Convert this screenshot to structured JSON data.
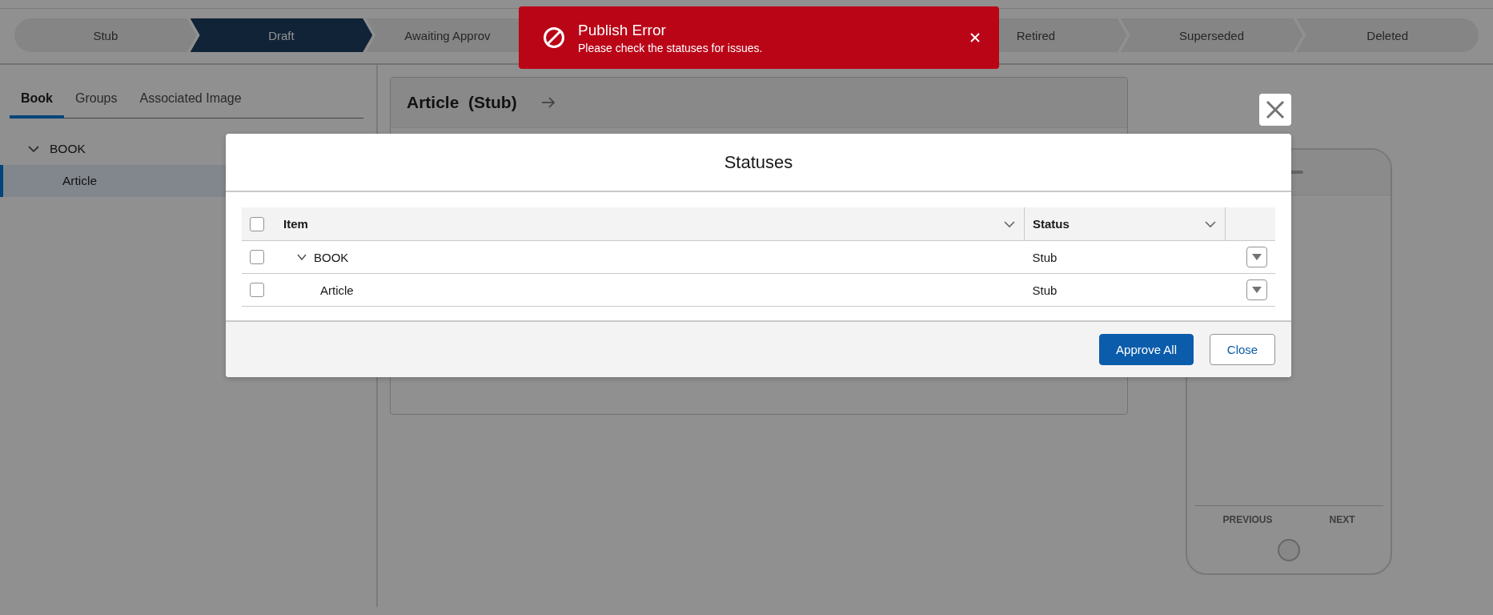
{
  "path": {
    "stages": [
      {
        "label": "Stub",
        "selected": false
      },
      {
        "label": "Draft",
        "selected": true
      },
      {
        "label": "Awaiting Approv",
        "selected": false
      },
      {
        "label": "Retired",
        "selected": false
      },
      {
        "label": "Superseded",
        "selected": false
      },
      {
        "label": "Deleted",
        "selected": false
      }
    ]
  },
  "sidebar": {
    "tabs": [
      {
        "label": "Book",
        "selected": true
      },
      {
        "label": "Groups",
        "selected": false
      },
      {
        "label": "Associated Image",
        "selected": false
      }
    ],
    "tree": [
      {
        "label": "BOOK",
        "expanded": true,
        "selected": false,
        "children": [
          {
            "label": "Article",
            "selected": true
          }
        ]
      }
    ]
  },
  "record": {
    "title": "Article",
    "status": "(Stub)"
  },
  "preview": {
    "previous": "PREVIOUS",
    "next": "NEXT"
  },
  "modal": {
    "title": "Statuses",
    "table": {
      "header_checked": false,
      "columns": [
        "Item",
        "Status"
      ],
      "rows": [
        {
          "item": "BOOK",
          "status": "Stub",
          "checked": false,
          "expanded": true,
          "children": [
            {
              "item": "Article",
              "status": "Stub",
              "checked": false
            }
          ]
        }
      ]
    },
    "buttons": [
      {
        "label": "Approve All",
        "kind": "primary"
      },
      {
        "label": "Close",
        "kind": "neutral"
      }
    ]
  },
  "toast": {
    "title": "Publish Error",
    "message": "Please check the statuses for issues.",
    "kind": "error"
  }
}
